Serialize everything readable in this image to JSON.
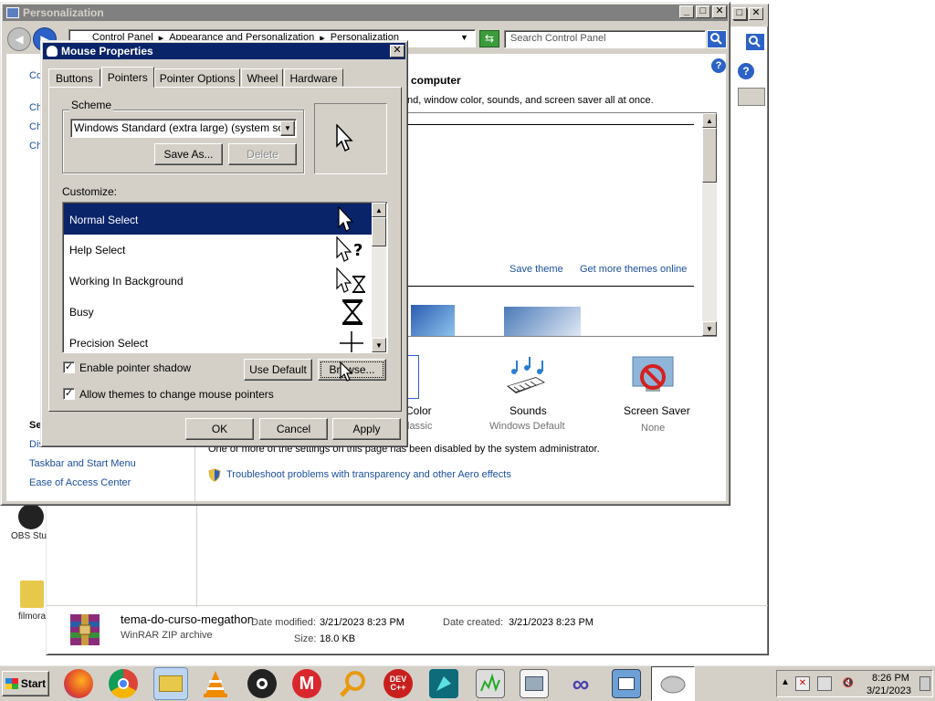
{
  "background_window": {
    "title": "Personalization",
    "breadcrumb": [
      "Control Panel",
      "Appearance and Personalization",
      "Personalization"
    ],
    "search_placeholder": "Search Control Panel",
    "heading": "computer",
    "description": "nd, window color, sounds, and screen saver all at once.",
    "sidebar_top_label": "Co",
    "sidebar_items": [
      "Ch",
      "Ch",
      "Ch"
    ],
    "see_also_label": "Se",
    "see_also_display": "Dis",
    "links_bottom": [
      "Taskbar and Start Menu",
      "Ease of Access Center"
    ],
    "theme_links": [
      "Save theme",
      "Get more themes online"
    ],
    "settings": [
      {
        "label": "Color",
        "sub": "lassic"
      },
      {
        "label": "Sounds",
        "sub": "Windows Default"
      },
      {
        "label": "Screen Saver",
        "sub": "None"
      }
    ],
    "disabled_note": "One or more of the settings on this page has been disabled by the system administrator.",
    "troubleshoot": "Troubleshoot problems with transparency and other Aero effects"
  },
  "dialog": {
    "title": "Mouse Properties",
    "tabs": [
      "Buttons",
      "Pointers",
      "Pointer Options",
      "Wheel",
      "Hardware"
    ],
    "active_tab": "Pointers",
    "scheme_label": "Scheme",
    "scheme_value": "Windows Standard (extra large) (system scheme)",
    "save_as": "Save As...",
    "delete": "Delete",
    "customize_label": "Customize:",
    "cursor_list": [
      {
        "name": "Normal Select",
        "icon": "arrow-cursor-icon",
        "selected": true
      },
      {
        "name": "Help Select",
        "icon": "help-cursor-icon",
        "selected": false
      },
      {
        "name": "Working In Background",
        "icon": "working-cursor-icon",
        "selected": false
      },
      {
        "name": "Busy",
        "icon": "hourglass-cursor-icon",
        "selected": false
      },
      {
        "name": "Precision Select",
        "icon": "crosshair-cursor-icon",
        "selected": false
      }
    ],
    "enable_shadow": "Enable pointer shadow",
    "use_default": "Use Default",
    "browse": "Browse...",
    "allow_themes": "Allow themes to change mouse pointers",
    "ok": "OK",
    "cancel": "Cancel",
    "apply": "Apply"
  },
  "desktop_icons": [
    "OBS Stu",
    "filmora"
  ],
  "explorer_details": {
    "file_name": "tema-do-curso-megathon",
    "file_type": "WinRAR ZIP archive",
    "date_modified_label": "Date modified:",
    "date_modified": "3/21/2023 8:23 PM",
    "size_label": "Size:",
    "size": "18.0 KB",
    "date_created_label": "Date created:",
    "date_created": "3/21/2023 8:23 PM"
  },
  "taskbar": {
    "start": "Start",
    "time": "8:26 PM",
    "date": "3/21/2023",
    "dev_label": "DEV C++"
  },
  "colors": {
    "titlebar_active": "#0a246a",
    "titlebar_inactive": "#808080",
    "selection": "#0a246a",
    "face": "#d4d0c8",
    "link": "#1c4fa0"
  }
}
